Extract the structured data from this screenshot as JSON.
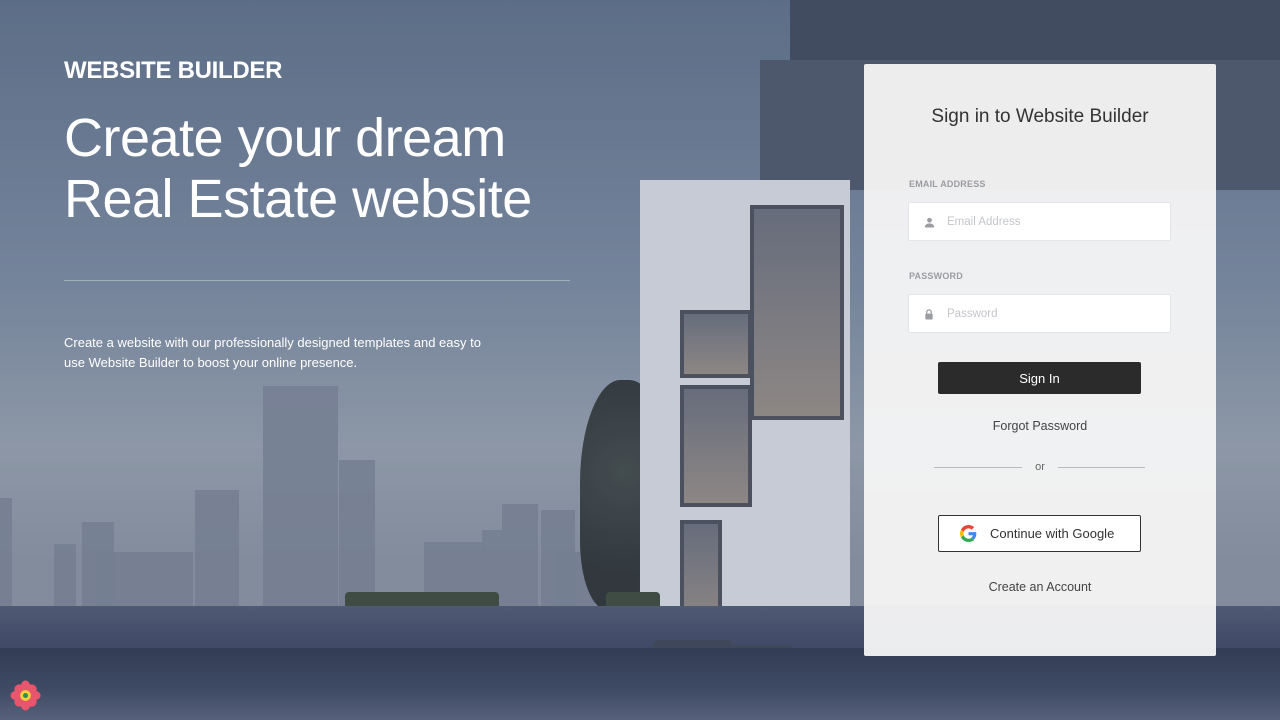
{
  "brand": {
    "name": "WEBSITE BUILDER"
  },
  "hero": {
    "line1": "Create your dream",
    "line2": "Real Estate website",
    "description": "Create a website with our professionally designed templates and easy to use Website Builder to boost your online presence."
  },
  "signin": {
    "title": "Sign in to Website Builder",
    "email_label": "EMAIL ADDRESS",
    "email_placeholder": "Email Address",
    "email_value": "",
    "password_label": "PASSWORD",
    "password_placeholder": "Password",
    "password_value": "",
    "submit_label": "Sign In",
    "forgot_label": "Forgot Password",
    "or_label": "or",
    "google_label": "Continue with Google",
    "create_label": "Create an Account"
  },
  "icons": {
    "email": "user-icon",
    "password": "lock-icon",
    "google": "google-icon",
    "corner_badge": "flower-icon"
  },
  "colors": {
    "primary_button": "#2b2b2c",
    "card_background": "#f5f5f6",
    "text_white": "#ffffff"
  }
}
